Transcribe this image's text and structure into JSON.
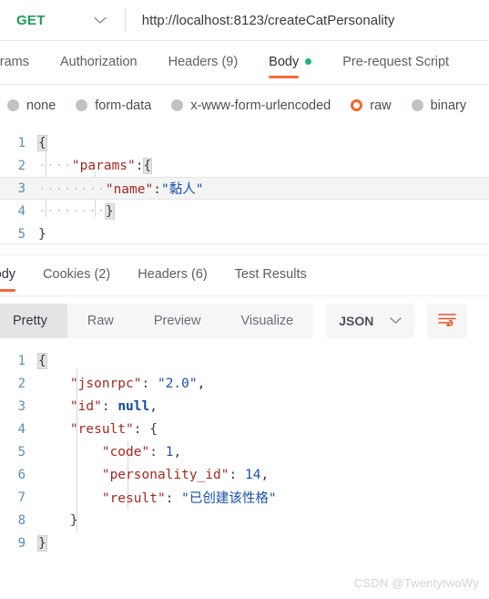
{
  "request_bar": {
    "method": "GET",
    "method_icon": "chevron-down-icon",
    "url": "http://localhost:8123/createCatPersonality"
  },
  "request_tabs": [
    {
      "label": "Params",
      "active": false
    },
    {
      "label": "Authorization",
      "active": false
    },
    {
      "label": "Headers (9)",
      "active": false
    },
    {
      "label": "Body",
      "active": true,
      "dot": true
    },
    {
      "label": "Pre-request Script",
      "active": false
    }
  ],
  "body_type_options": [
    {
      "label": "none",
      "selected": false
    },
    {
      "label": "form-data",
      "selected": false
    },
    {
      "label": "x-www-form-urlencoded",
      "selected": false
    },
    {
      "label": "raw",
      "selected": true
    },
    {
      "label": "binary",
      "selected": false
    }
  ],
  "request_body": {
    "language": "json",
    "lines": [
      {
        "number": "1",
        "text": "{"
      },
      {
        "number": "2",
        "text": "    \"params\":{"
      },
      {
        "number": "3",
        "text": "        \"name\":\"黏人\"",
        "active": true
      },
      {
        "number": "4",
        "text": "        }"
      },
      {
        "number": "5",
        "text": "}"
      }
    ]
  },
  "response_tabs": [
    {
      "label": "Body",
      "active": true
    },
    {
      "label": "Cookies (2)",
      "active": false
    },
    {
      "label": "Headers (6)",
      "active": false
    },
    {
      "label": "Test Results",
      "active": false
    }
  ],
  "response_toolbar": {
    "views": [
      {
        "label": "Pretty",
        "active": true
      },
      {
        "label": "Raw",
        "active": false
      },
      {
        "label": "Preview",
        "active": false
      },
      {
        "label": "Visualize",
        "active": false
      }
    ],
    "format_selected": "JSON",
    "format_chevron": "chevron-down-icon",
    "wrap_button_icon": "wrap-lines-icon"
  },
  "response_body": {
    "language": "json",
    "lines": [
      {
        "number": "1",
        "text": "{"
      },
      {
        "number": "2",
        "text": "    \"jsonrpc\": \"2.0\","
      },
      {
        "number": "3",
        "text": "    \"id\": null,"
      },
      {
        "number": "4",
        "text": "    \"result\": {"
      },
      {
        "number": "5",
        "text": "        \"code\": 1,"
      },
      {
        "number": "6",
        "text": "        \"personality_id\": 14,"
      },
      {
        "number": "7",
        "text": "        \"result\": \"已创建该性格\""
      },
      {
        "number": "8",
        "text": "    }"
      },
      {
        "number": "9",
        "text": "}"
      }
    ],
    "values": {
      "jsonrpc": "2.0",
      "id": "null",
      "result": {
        "code": "1",
        "personality_id": "14",
        "result": "已创建该性格"
      }
    }
  },
  "watermark": "CSDN @TwentytwoWy",
  "colors": {
    "accent_orange": "#f26b3a",
    "method_green": "#1e9e57",
    "dot_green": "#21b573",
    "json_key": "#a4291f",
    "json_string": "#1750b0",
    "line_number": "#5a8db5"
  }
}
